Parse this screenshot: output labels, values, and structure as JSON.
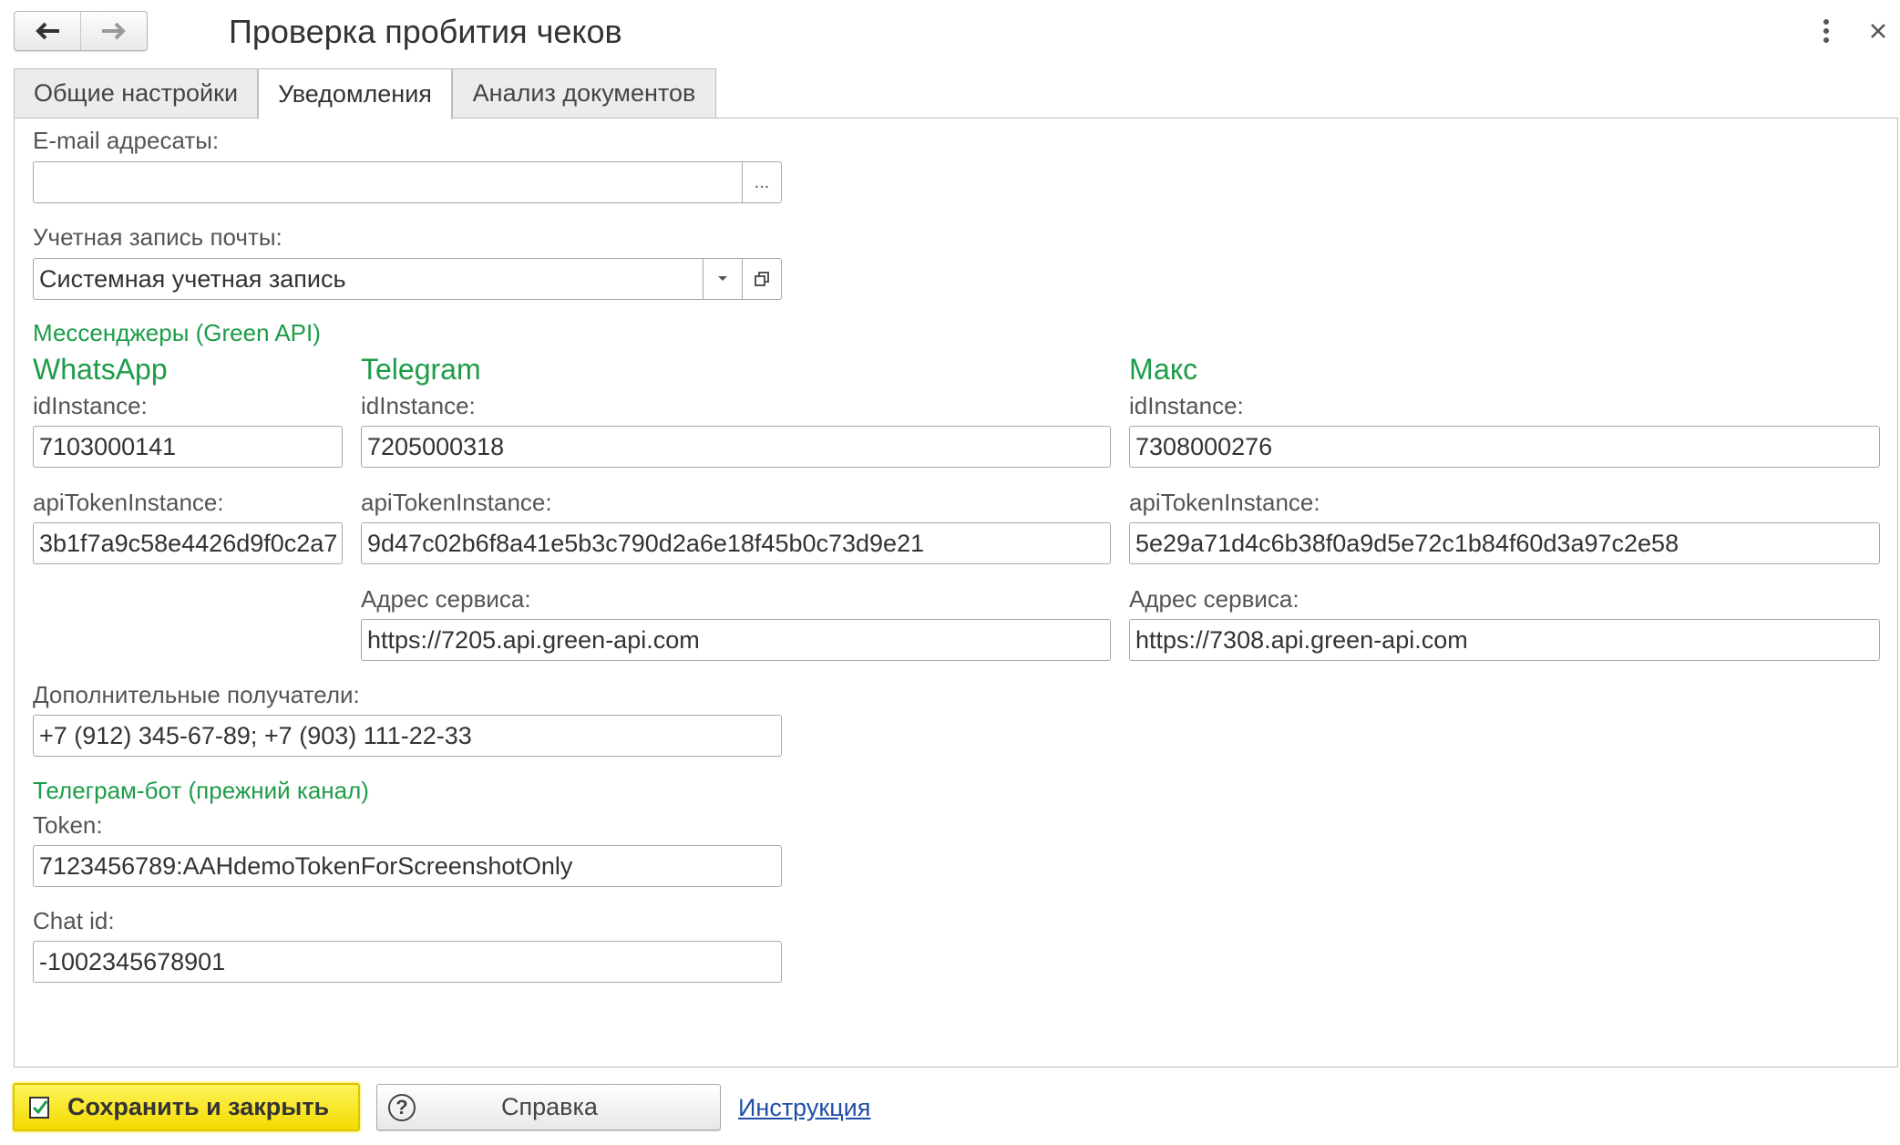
{
  "window": {
    "title": "Проверка пробития чеков",
    "icons": {
      "back": "arrow-left-icon",
      "forward": "arrow-right-icon",
      "more": "more-vertical-icon",
      "close": "close-icon"
    }
  },
  "tabs": [
    {
      "label": "Общие настройки",
      "active": false
    },
    {
      "label": "Уведомления",
      "active": true
    },
    {
      "label": "Анализ документов",
      "active": false
    }
  ],
  "form": {
    "email": {
      "label": "E-mail адресаты:",
      "value": "",
      "button": "..."
    },
    "mail_account": {
      "label": "Учетная запись почты:",
      "value": "Системная учетная запись"
    },
    "messengers_heading": "Мессенджеры (Green API)",
    "whatsapp": {
      "title": "WhatsApp",
      "id_label": "idInstance:",
      "id_value": "7103000141",
      "token_label": "apiTokenInstance:",
      "token_value": "3b1f7a9c58e4426d9f0c2a7"
    },
    "telegram": {
      "title": "Telegram",
      "id_label": "idInstance:",
      "id_value": "7205000318",
      "token_label": "apiTokenInstance:",
      "token_value": "9d47c02b6f8a41e5b3c790d2a6e18f45b0c73d9e21",
      "service_label": "Адрес сервиса:",
      "service_value": "https://7205.api.green-api.com"
    },
    "max": {
      "title": "Макс",
      "id_label": "idInstance:",
      "id_value": "7308000276",
      "token_label": "apiTokenInstance:",
      "token_value": "5e29a71d4c6b38f0a9d5e72c1b84f60d3a97c2e58",
      "service_label": "Адрес сервиса:",
      "service_value": "https://7308.api.green-api.com"
    },
    "extra_recipients": {
      "label": "Дополнительные получатели:",
      "value": "+7 (912) 345-67-89; +7 (903) 111-22-33"
    },
    "telegram_bot_heading": "Телеграм-бот (прежний канал)",
    "bot_token": {
      "label": "Token:",
      "value": "7123456789:AAHdemoTokenForScreenshotOnly"
    },
    "chat_id": {
      "label": "Chat id:",
      "value": "-1002345678901"
    }
  },
  "footer": {
    "save_label": "Сохранить и закрыть",
    "help_label": "Справка",
    "instruction_link": "Инструкция"
  },
  "colors": {
    "accent_green": "#1d9c48",
    "save_yellow": "#f3db00",
    "link_blue": "#1f4fa8"
  }
}
